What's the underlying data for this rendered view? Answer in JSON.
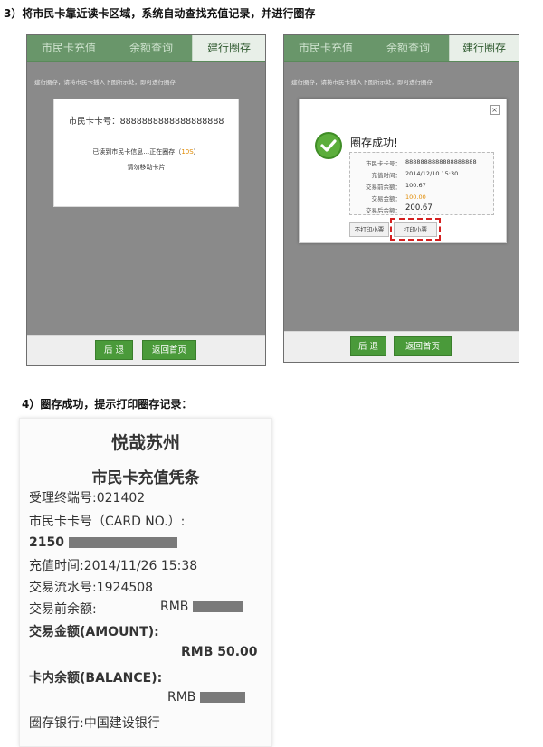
{
  "step3": {
    "title": "3）将市民卡靠近读卡区域，系统自动查找充值记录，并进行圈存"
  },
  "step4": {
    "title": "4）圈存成功，提示打印圈存记录："
  },
  "tabs": [
    "市民卡充值",
    "余额查询",
    "建行圈存"
  ],
  "hint": "建行圈存，请将市民卡插入下图所示处，即可进行圈存",
  "screen1": {
    "card_label": "市民卡卡号：",
    "card_number": "8888888888888888888",
    "reading_prefix": "已读到市民卡信息…正在圈存（",
    "reading_count": "10S",
    "reading_suffix": "）",
    "warning": "请勿移动卡片"
  },
  "screen2": {
    "close": "×",
    "success_title": "圈存成功!",
    "details": [
      {
        "label": "市民卡卡号：",
        "value": "8888888888888888888"
      },
      {
        "label": "充值时间：",
        "value": "2014/12/10 15:30"
      },
      {
        "label": "交易前余额：",
        "value": "100.67"
      },
      {
        "label": "交易金额：",
        "value": "100.00"
      },
      {
        "label": "交易后余额：",
        "value": "200.67"
      }
    ],
    "no_print": "不打印小票",
    "print": "打印小票"
  },
  "footer": {
    "back": "后 退",
    "home": "返回首页"
  },
  "receipt": {
    "title": "悦哉苏州",
    "subtitle": "市民卡充值凭条",
    "terminal": "受理终端号:021402",
    "card_no_label": "市民卡卡号（CARD NO.）:",
    "card_no_prefix": "2150",
    "time": "充值时间:2014/11/26 15:38",
    "serial": "交易流水号:1924508",
    "before_label": "交易前余额:",
    "currency": "RMB",
    "amount_label": "交易金额(AMOUNT):",
    "amount_value": "RMB 50.00",
    "balance_label": "卡内余额(BALANCE):",
    "bank": "圈存银行:中国建设银行"
  },
  "colors": {
    "tab_green": "#69966a",
    "button_green": "#4a9a3a",
    "orange": "#e08a00",
    "highlight_red": "#d42020"
  }
}
